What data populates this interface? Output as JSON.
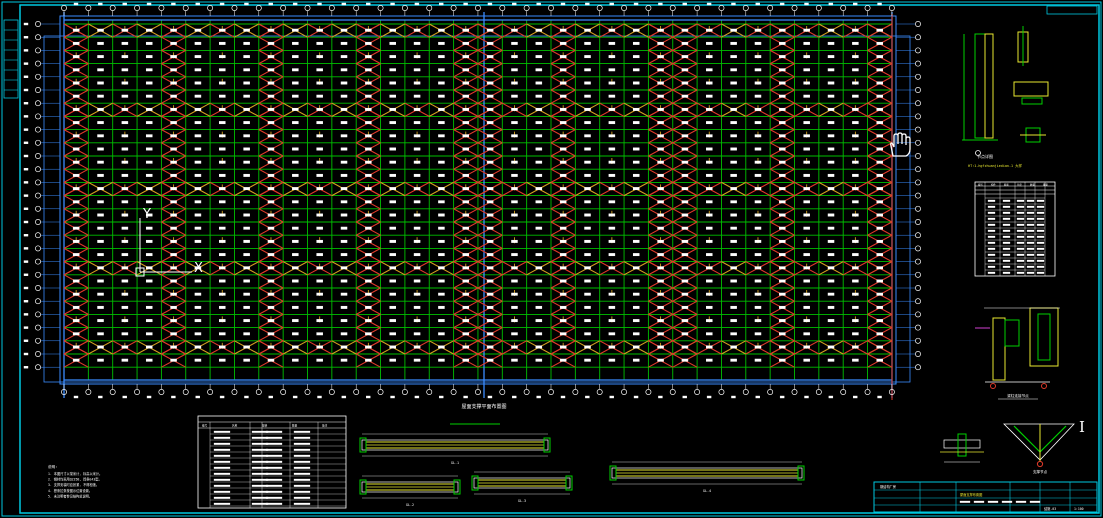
{
  "colors": {
    "background": "#000000",
    "frame": "#00c8e0",
    "axis": "#3a8cff",
    "purlin": "#00c000",
    "brace": "#e03a2a",
    "brace_alt": "#d4a020",
    "text": "#ffffff",
    "detail_yellow": "#e8e830",
    "detail_green": "#00d000",
    "magenta": "#d040d0"
  },
  "plan": {
    "title": "屋面支撑平面布置图",
    "ucs_label_y": "Y",
    "ucs_label_x": "X"
  },
  "details": {
    "node_title": "节点详图",
    "node_note": "HT:1-hgfzhuanjiedian-1 大样",
    "connection_title": "梁柱连接节点",
    "brace_title": "支撑节点",
    "section_mark": "I",
    "beam_titles": [
      "GL-1",
      "GL-2",
      "GL-3",
      "GL-4"
    ]
  },
  "member_table": {
    "headers": [
      "编号",
      "构件",
      "截面",
      "长度",
      "数量",
      "重量"
    ]
  },
  "material_table": {
    "headers": [
      "编号",
      "名称",
      "规格",
      "数量",
      "备注"
    ]
  },
  "notes": {
    "heading": "说明:",
    "lines": [
      "1. 本图尺寸以毫米计, 标高以米计。",
      "2. 钢材均采用Q235B, 焊条E43型。",
      "3. 支撑安装时应张紧, 不得松弛。",
      "4. 檩条拉条按图示位置设置。",
      "5. 未注明者参见结构总说明。"
    ]
  },
  "title_block": {
    "project": "钢结构厂房",
    "drawing": "屋面支撑布置图",
    "sheet": "结施-03",
    "scale": "1:100"
  }
}
